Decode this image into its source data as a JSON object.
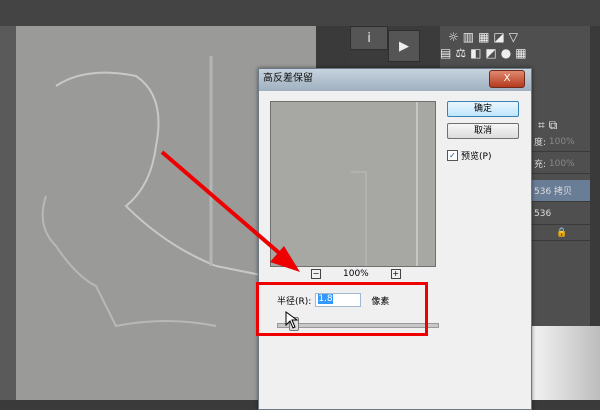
{
  "dialog": {
    "title": "高反差保留",
    "close": "X",
    "ok": "确定",
    "cancel": "取消",
    "preview_label": "预览(P)",
    "preview_checked": true,
    "zoom": "100%",
    "zoom_out": "−",
    "zoom_in": "+",
    "radius_label": "半径(R):",
    "radius_value": "1.8",
    "radius_unit": "像素"
  },
  "panel": {
    "opacity_label": "度:",
    "opacity_value": "100%",
    "fill_label": "充:",
    "fill_value": "100%",
    "layers": [
      "536 拷贝",
      "536"
    ]
  },
  "toolbar": {
    "info": "i",
    "play": "▶"
  },
  "colors": {
    "annotation": "#ee0000",
    "selection": "#3399ff"
  }
}
